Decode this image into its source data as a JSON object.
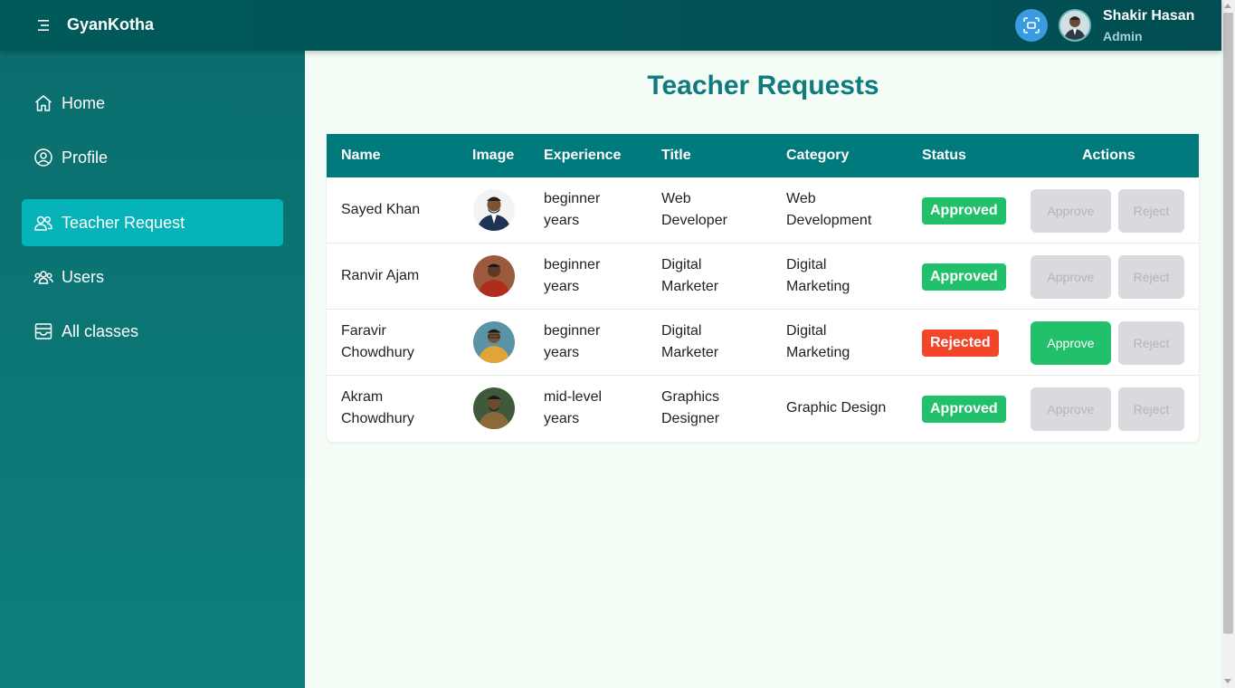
{
  "app": {
    "brand": "GyanKotha"
  },
  "user": {
    "name": "Shakir Hasan",
    "role": "Admin"
  },
  "sidebar": {
    "items": [
      {
        "label": "Home",
        "icon": "home-icon",
        "active": false
      },
      {
        "label": "Profile",
        "icon": "user-circle-icon",
        "active": false
      },
      {
        "label": "Teacher Request",
        "icon": "users-icon",
        "active": true
      },
      {
        "label": "Users",
        "icon": "group-icon",
        "active": false
      },
      {
        "label": "All classes",
        "icon": "archive-icon",
        "active": false
      }
    ]
  },
  "page": {
    "title": "Teacher Requests"
  },
  "table": {
    "headers": [
      "Name",
      "Image",
      "Experience",
      "Title",
      "Category",
      "Status",
      "Actions"
    ],
    "rows": [
      {
        "name_line1": "Sayed Khan",
        "name_line2": "",
        "exp_line1": "beginner",
        "exp_line2": "years",
        "title_line1": "Web",
        "title_line2": "Developer",
        "cat_line1": "Web",
        "cat_line2": "Development",
        "status": "Approved",
        "approve": "Approve",
        "reject": "Reject"
      },
      {
        "name_line1": "Ranvir Ajam",
        "name_line2": "",
        "exp_line1": "beginner",
        "exp_line2": "years",
        "title_line1": "Digital",
        "title_line2": "Marketer",
        "cat_line1": "Digital",
        "cat_line2": "Marketing",
        "status": "Approved",
        "approve": "Approve",
        "reject": "Reject"
      },
      {
        "name_line1": "Faravir",
        "name_line2": "Chowdhury",
        "exp_line1": "beginner",
        "exp_line2": "years",
        "title_line1": "Digital",
        "title_line2": "Marketer",
        "cat_line1": "Digital",
        "cat_line2": "Marketing",
        "status": "Rejected",
        "approve": "Approve",
        "reject": "Reject"
      },
      {
        "name_line1": "Akram",
        "name_line2": "Chowdhury",
        "exp_line1": "mid-level",
        "exp_line2": "years",
        "title_line1": "Graphics",
        "title_line2": "Designer",
        "cat_line1": "Graphic Design",
        "cat_line2": "",
        "status": "Approved",
        "approve": "Approve",
        "reject": "Reject"
      }
    ]
  },
  "colors": {
    "topbar": "#015a5a",
    "sidebar": "#0b6e6e",
    "active_nav": "#06b3b8",
    "table_header": "#017a7d",
    "approved": "#22c06a",
    "rejected": "#f2452a",
    "title": "#0f7b7e"
  }
}
